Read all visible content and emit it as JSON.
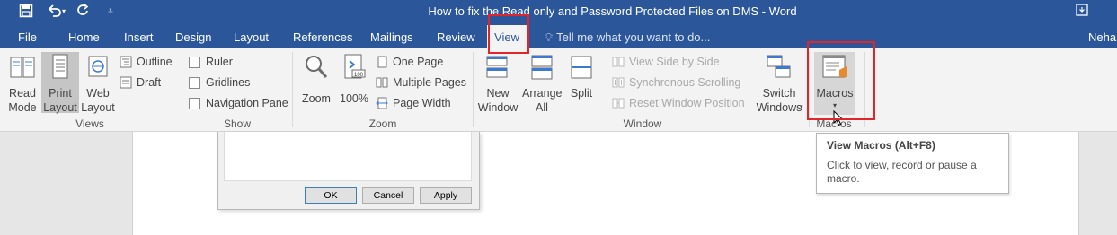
{
  "title_bar": {
    "document_title": "How to fix the Read only and Password Protected Files on DMS - Word",
    "qat": [
      "save-icon",
      "undo-icon",
      "redo-icon",
      "customize-qat-icon"
    ]
  },
  "tabs": [
    "File",
    "Home",
    "Insert",
    "Design",
    "Layout",
    "References",
    "Mailings",
    "Review",
    "View"
  ],
  "active_tab": "View",
  "tell_me": "Tell me what you want to do...",
  "user": "Neha",
  "ribbon": {
    "views": {
      "label": "Views",
      "read_mode": [
        "Read",
        "Mode"
      ],
      "print_layout": [
        "Print",
        "Layout"
      ],
      "web_layout": [
        "Web",
        "Layout"
      ],
      "outline": "Outline",
      "draft": "Draft"
    },
    "show": {
      "label": "Show",
      "ruler": "Ruler",
      "gridlines": "Gridlines",
      "navigation_pane": "Navigation Pane"
    },
    "zoom": {
      "label": "Zoom",
      "zoom": "Zoom",
      "hundred": "100%",
      "one_page": "One Page",
      "multiple_pages": "Multiple Pages",
      "page_width": "Page Width"
    },
    "window": {
      "label": "Window",
      "new_window": [
        "New",
        "Window"
      ],
      "arrange_all": [
        "Arrange",
        "All"
      ],
      "split": "Split",
      "view_side_by_side": "View Side by Side",
      "synchronous_scrolling": "Synchronous Scrolling",
      "reset_window_position": "Reset Window Position",
      "switch_windows": [
        "Switch",
        "Windows"
      ]
    },
    "macros": {
      "label": "Macros",
      "macros": "Macros"
    }
  },
  "dialog": {
    "ok": "OK",
    "cancel": "Cancel",
    "apply": "Apply"
  },
  "tooltip": {
    "title": "View Macros (Alt+F8)",
    "description": "Click to view, record or pause a macro."
  },
  "colors": {
    "title_bar": "#2b579a",
    "highlight_box": "#e0252b",
    "ribbon_background": "#f3f3f3"
  }
}
